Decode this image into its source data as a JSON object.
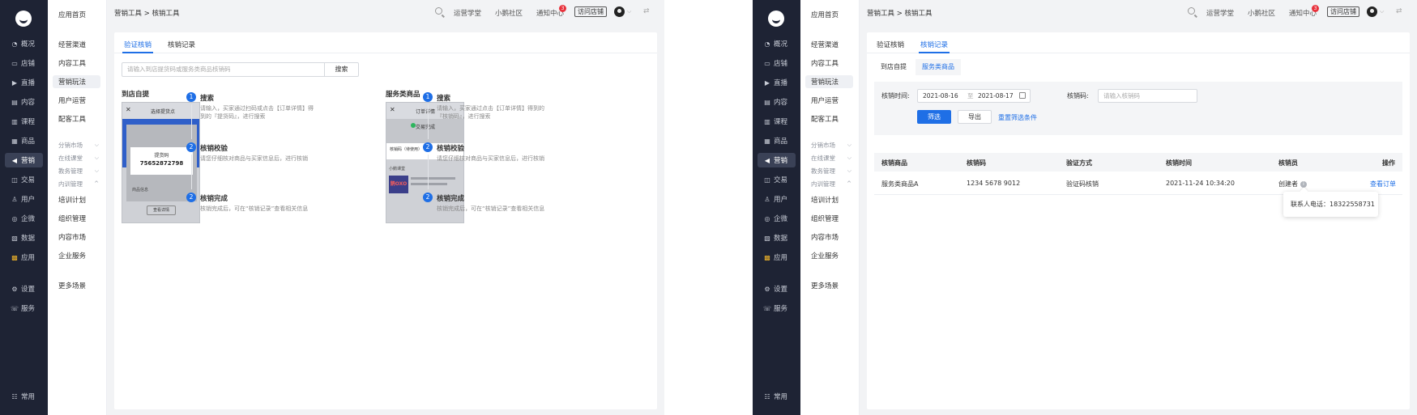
{
  "rail": {
    "items": [
      {
        "icon": "◔",
        "label": "概况"
      },
      {
        "icon": "▭",
        "label": "店铺"
      },
      {
        "icon": "▶",
        "label": "直播"
      },
      {
        "icon": "▤",
        "label": "内容"
      },
      {
        "icon": "▥",
        "label": "课程"
      },
      {
        "icon": "▦",
        "label": "商品"
      },
      {
        "icon": "◀",
        "label": "营销"
      },
      {
        "icon": "◫",
        "label": "交易"
      },
      {
        "icon": "♙",
        "label": "用户"
      },
      {
        "icon": "◎",
        "label": "企微"
      },
      {
        "icon": "▧",
        "label": "数据"
      },
      {
        "icon": "▩",
        "label": "应用"
      },
      {
        "icon": "⚙",
        "label": "设置"
      },
      {
        "icon": "☏",
        "label": "服务"
      }
    ],
    "bottom": {
      "icon": "☷",
      "label": "常用"
    }
  },
  "subnav": {
    "home": "应用首页",
    "items_top": [
      "经营渠道",
      "内容工具",
      "营销玩法",
      "用户运营",
      "配客工具"
    ],
    "groups": [
      "分销市场",
      "在线课堂",
      "教务管理",
      "内训管理"
    ],
    "items_bottom": [
      "培训计划",
      "组织管理",
      "内容市场",
      "企业服务"
    ],
    "more": "更多场景"
  },
  "header": {
    "breadcrumb": "营销工具 > 核销工具",
    "links": [
      "运营学堂",
      "小鹅社区",
      "通知中心"
    ],
    "notify_count": "3",
    "visit_store": "访问店铺"
  },
  "tabs": [
    "验证核销",
    "核销记录"
  ],
  "verify": {
    "placeholder": "请输入到店提货码或服务类商品核销码",
    "search_label": "搜索",
    "flows": [
      {
        "title": "到店自提",
        "phone": {
          "header": "选择提货点",
          "code_label": "提货码",
          "code": "75652872798",
          "button": "查看详情",
          "section": "商品信息"
        },
        "steps": [
          {
            "num": "1",
            "title": "搜索",
            "desc": [
              "请输入，买家通过扫码或点击【订单详情】得",
              "到的『提货码』，进行搜索"
            ]
          },
          {
            "num": "2",
            "title": "核销校验",
            "desc": [
              "请您仔细核对商品与买家信息后，进行核销"
            ]
          },
          {
            "num": "2",
            "title": "核销完成",
            "desc": [
              "核销完成后，可在“核销记录”查看相关信息"
            ]
          }
        ]
      },
      {
        "title": "服务类商品",
        "phone": {
          "header": "订单详情",
          "status": "交易完成",
          "code_label": "核销码（待使用）",
          "section": "小鹅课堂",
          "brand": "鹅OXO"
        },
        "steps": [
          {
            "num": "1",
            "title": "搜索",
            "desc": [
              "请输入，买家通过点击【订单详情】得到的",
              "『核销码』，进行搜索"
            ]
          },
          {
            "num": "2",
            "title": "核销校验",
            "desc": [
              "请您仔细核对商品与买家信息后，进行核销"
            ]
          },
          {
            "num": "2",
            "title": "核销完成",
            "desc": [
              "核销完成后，可在“核销记录”查看相关信息"
            ]
          }
        ]
      }
    ]
  },
  "records": {
    "subtabs": [
      "到店自提",
      "服务类商品"
    ],
    "filter": {
      "time_label": "核销时间:",
      "date_from": "2021-08-16",
      "date_sep": "至",
      "date_to": "2021-08-17",
      "code_label": "核销码:",
      "code_placeholder": "请输入核销码",
      "filter_btn": "筛选",
      "export_btn": "导出",
      "reset_link": "重置筛选条件"
    },
    "columns": [
      "核销商品",
      "核销码",
      "验证方式",
      "核销时间",
      "核销员",
      "操作"
    ],
    "rows": [
      {
        "product": "服务类商品A",
        "code": "1234 5678 9012",
        "method": "验证码核销",
        "time": "2021-11-24 10:34:20",
        "operator": "创建者",
        "action": "查看订单"
      }
    ],
    "tooltip": "联系人电话：18322558731"
  },
  "colors": {
    "accent": "#1f6fe6",
    "rail": "#1e2334",
    "badge": "#e8323c"
  }
}
